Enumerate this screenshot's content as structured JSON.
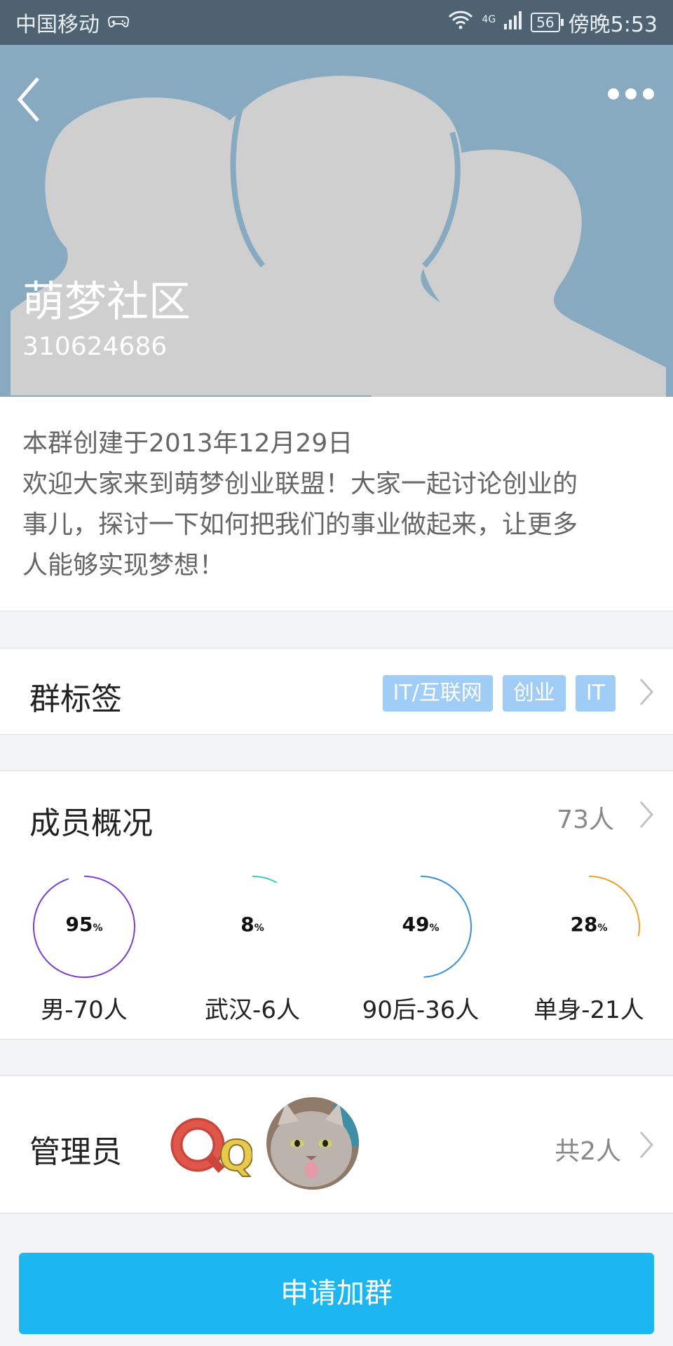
{
  "status_bar": {
    "carrier": "中国移动",
    "network": "4G",
    "battery": "56",
    "time": "傍晚5:53"
  },
  "header": {
    "group_name": "萌梦社区",
    "group_id": "310624686",
    "colors": {
      "background": "#87aac0",
      "silhouette": "#cfcfcf"
    }
  },
  "intro": {
    "created": "本群创建于2013年12月29日",
    "description_lines": [
      "欢迎大家来到萌梦创业联盟！大家一起讨论创业的",
      "事儿，探讨一下如何把我们的事业做起来，让更多",
      "人能够实现梦想！"
    ]
  },
  "tags_row": {
    "title": "群标签",
    "tags": [
      "IT/互联网",
      "创业",
      "IT"
    ]
  },
  "members_row": {
    "title": "成员概况",
    "count": "73人"
  },
  "stats": [
    {
      "value": "95",
      "unit": "%",
      "label": "男-70人",
      "fraction": 0.95,
      "color": "#7b3fc8"
    },
    {
      "value": "8",
      "unit": "%",
      "label": "武汉-6人",
      "fraction": 0.08,
      "color": "#3cc9c0"
    },
    {
      "value": "49",
      "unit": "%",
      "label": "90后-36人",
      "fraction": 0.49,
      "color": "#3a8fd6"
    },
    {
      "value": "28",
      "unit": "%",
      "label": "单身-21人",
      "fraction": 0.28,
      "color": "#e6a22a"
    }
  ],
  "admin_row": {
    "title": "管理员",
    "total": "共2人",
    "avatar1_text": "Qt"
  },
  "join_button": {
    "label": "申请加群",
    "color": "#1cb7f1"
  }
}
